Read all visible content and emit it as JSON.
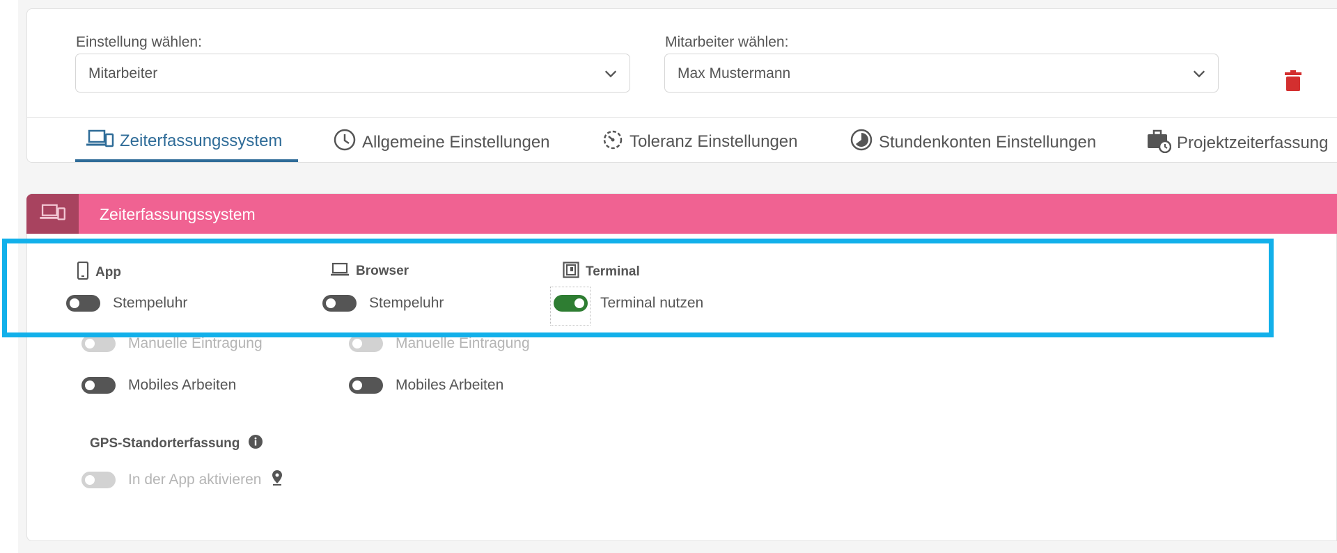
{
  "filters": {
    "setting_label": "Einstellung wählen:",
    "setting_value": "Mitarbeiter",
    "employee_label": "Mitarbeiter wählen:",
    "employee_value": "Max Mustermann"
  },
  "tabs": [
    {
      "label": "Zeiterfassungssystem",
      "icon": "devices-icon",
      "active": true
    },
    {
      "label": "Allgemeine Einstellungen",
      "icon": "clock-icon"
    },
    {
      "label": "Toleranz Einstellungen",
      "icon": "timer-icon"
    },
    {
      "label": "Stundenkonten Einstellungen",
      "icon": "pie-clock-icon"
    },
    {
      "label": "Projektzeiterfassung",
      "icon": "briefcase-clock-icon"
    }
  ],
  "section": {
    "title": "Zeiterfassungssystem",
    "accent": "#f06292",
    "icon_bg": "#a8435f"
  },
  "columns": {
    "app": {
      "heading": "App",
      "stempeluhr": {
        "label": "Stempeluhr",
        "on": false
      },
      "manual": {
        "label": "Manuelle Eintragung",
        "on": false,
        "disabled": true
      },
      "mobile": {
        "label": "Mobiles Arbeiten",
        "on": false
      }
    },
    "browser": {
      "heading": "Browser",
      "stempeluhr": {
        "label": "Stempeluhr",
        "on": false
      },
      "manual": {
        "label": "Manuelle Eintragung",
        "on": false,
        "disabled": true
      },
      "mobile": {
        "label": "Mobiles Arbeiten",
        "on": false
      }
    },
    "terminal": {
      "heading": "Terminal",
      "use": {
        "label": "Terminal nutzen",
        "on": true
      }
    }
  },
  "gps": {
    "heading": "GPS-Standorterfassung",
    "toggle_label": "In der App aktivieren",
    "on": false,
    "disabled": true
  },
  "colors": {
    "active_tab": "#2f6c98",
    "toggle_on": "#2e7d32",
    "delete": "#d32f2f",
    "highlight": "#12b0ea"
  }
}
